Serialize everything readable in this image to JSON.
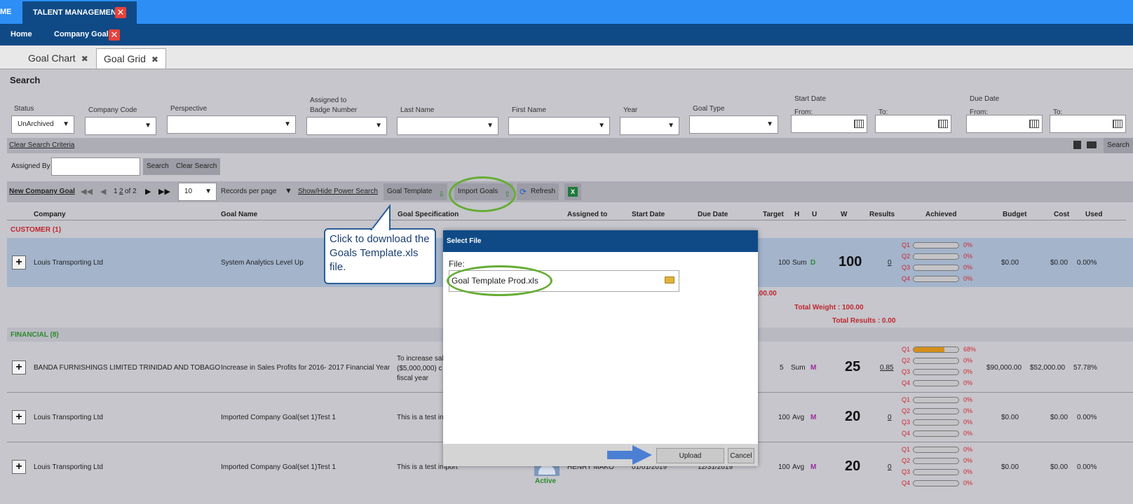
{
  "topbar": {
    "me_label": "ME",
    "module_tab": "TALENT MANAGEMENT"
  },
  "navbar": {
    "home": "Home",
    "company_goals": "Company Goals"
  },
  "page_tabs": [
    {
      "label": "Goal Chart"
    },
    {
      "label": "Goal Grid"
    }
  ],
  "search": {
    "title": "Search",
    "labels": {
      "status": "Status",
      "company_code": "Company Code",
      "perspective": "Perspective",
      "assigned_to": "Assigned to",
      "badge_number": "Badge Number",
      "last_name": "Last Name",
      "first_name": "First Name",
      "year": "Year",
      "goal_type": "Goal Type",
      "start_date": "Start Date",
      "due_date": "Due Date",
      "from": "From:",
      "to": "To:"
    },
    "status_value": "UnArchived",
    "clear_criteria": "Clear Search Criteria",
    "search_btn": "Search",
    "assigned_by": "Assigned By",
    "search_btn2": "Search",
    "clear_search": "Clear Search"
  },
  "toolbar": {
    "new_goal": "New Company Goal",
    "page_num_1": "1",
    "page_num_2": "2",
    "page_of": "of 2",
    "per_page": "10",
    "records_per_page": "Records per page",
    "power_search": "Show/Hide Power Search",
    "goal_template": "Goal Template",
    "import_goals": "Import Goals",
    "refresh": "Refresh"
  },
  "columns": {
    "company": "Company",
    "goal_name": "Goal Name",
    "goal_spec": "Goal Specification",
    "assigned_to": "Assigned to",
    "start_date": "Start Date",
    "due_date": "Due Date",
    "target": "Target",
    "h": "H",
    "u": "U",
    "w": "W",
    "results": "Results",
    "achieved": "Achieved",
    "budget": "Budget",
    "cost": "Cost",
    "used": "Used"
  },
  "groups": {
    "customer": "CUSTOMER",
    "customer_count": "(1)",
    "financial": "FINANCIAL",
    "financial_count": "(8)",
    "partial_total": ": 100.00",
    "total_weight": "Total Weight : 100.00",
    "total_results": "Total Results : 0.00"
  },
  "rows": [
    {
      "company": "Louis Transporting Ltd",
      "goal": "System Analytics Level Up",
      "spec": "",
      "target": "100",
      "h": "Sum",
      "u": "D",
      "w": "100",
      "results": "0",
      "q": [
        "Q1",
        "Q2",
        "Q3",
        "Q4"
      ],
      "pct": [
        "0%",
        "0%",
        "0%",
        "0%"
      ],
      "fill": [
        0,
        0,
        0,
        0
      ],
      "budget": "$0.00",
      "cost": "$0.00",
      "used": "0.00%"
    },
    {
      "company": "BANDA FURNISHINGS LIMITED TRINIDAD AND TOBAGO",
      "goal": "Increase in Sales Profits for 2016- 2017 Financial Year",
      "spec1": "To increase sal",
      "spec2": "($5,000,000) c",
      "spec3": "fiscal year",
      "target": "5",
      "h": "Sum",
      "u": "M",
      "w": "25",
      "results": "0.85",
      "q": [
        "Q1",
        "Q2",
        "Q3",
        "Q4"
      ],
      "pct": [
        "68%",
        "0%",
        "0%",
        "0%"
      ],
      "fill": [
        0.68,
        0,
        0,
        0
      ],
      "budget": "$90,000.00",
      "cost": "$52,000.00",
      "used": "57.78%"
    },
    {
      "company": "Louis Transporting Ltd",
      "goal": "Imported Company Goal(set 1)Test 1",
      "spec": "This is a test in",
      "target": "100",
      "h": "Avg",
      "u": "M",
      "w": "20",
      "results": "0",
      "q": [
        "Q1",
        "Q2",
        "Q3",
        "Q4"
      ],
      "pct": [
        "0%",
        "0%",
        "0%",
        "0%"
      ],
      "fill": [
        0,
        0,
        0,
        0
      ],
      "budget": "$0.00",
      "cost": "$0.00",
      "used": "0.00%"
    },
    {
      "company": "Louis Transporting Ltd",
      "goal": "Imported Company Goal(set 1)Test 1",
      "spec": "This is a test import",
      "assignee": "HENRY MAKO",
      "assignee_status": "Active",
      "start": "01/01/2019",
      "due": "12/31/2019",
      "target": "100",
      "h": "Avg",
      "u": "M",
      "w": "20",
      "results": "0",
      "q": [
        "Q1",
        "Q2",
        "Q3",
        "Q4"
      ],
      "pct": [
        "0%",
        "0%",
        "0%",
        "0%"
      ],
      "fill": [
        0,
        0,
        0,
        0
      ],
      "budget": "$0.00",
      "cost": "$0.00",
      "used": "0.00%"
    }
  ],
  "modal": {
    "title": "Select File",
    "file_label": "File:",
    "file_value": "Goal Template Prod.xls",
    "upload": "Upload",
    "cancel": "Cancel"
  },
  "callout": {
    "text": "Click to download the Goals Template.xls file."
  },
  "colors": {
    "header_blue": "#2d8ff5",
    "nav_navy": "#0f4a86",
    "highlight_green": "#65ad34",
    "annotation_blue": "#2a5d99",
    "red": "#d0262f"
  }
}
